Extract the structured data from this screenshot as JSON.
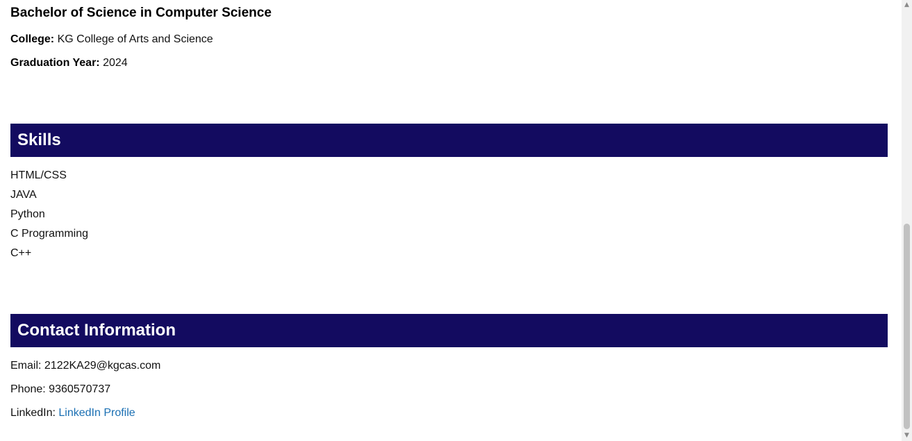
{
  "education": {
    "degree": "Bachelor of Science in Computer Science",
    "college_label": "College:",
    "college_value": "KG College of Arts and Science",
    "grad_label": "Graduation Year:",
    "grad_value": "2024"
  },
  "skills": {
    "title": "Skills",
    "items": [
      "HTML/CSS",
      "JAVA",
      "Python",
      "C Programming",
      "C++"
    ]
  },
  "contact": {
    "title": "Contact Information",
    "email_label": "Email:",
    "email_value": "2122KA29@kgcas.com",
    "phone_label": "Phone:",
    "phone_value": "9360570737",
    "linkedin_label": "LinkedIn:",
    "linkedin_link": "LinkedIn Profile"
  },
  "colors": {
    "header_bg": "#130b60",
    "link": "#1a6fb3"
  },
  "scrollbar": {
    "up_icon": "chevron-up-icon",
    "down_icon": "chevron-down-icon"
  }
}
